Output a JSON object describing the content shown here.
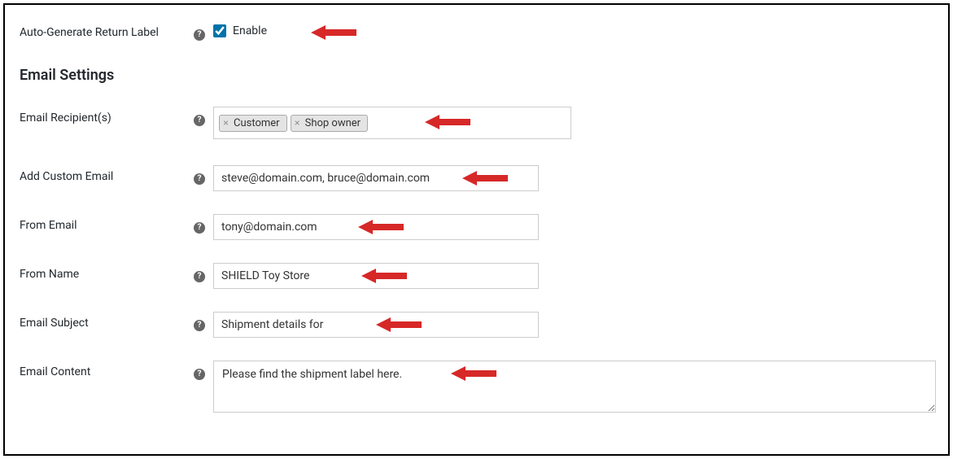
{
  "autoGenerate": {
    "label": "Auto-Generate Return Label",
    "checkboxLabel": "Enable",
    "checked": true
  },
  "sectionHeading": "Email Settings",
  "recipients": {
    "label": "Email Recipient(s)",
    "tags": [
      "Customer",
      "Shop owner"
    ]
  },
  "customEmail": {
    "label": "Add Custom Email",
    "value": "steve@domain.com, bruce@domain.com"
  },
  "fromEmail": {
    "label": "From Email",
    "value": "tony@domain.com"
  },
  "fromName": {
    "label": "From Name",
    "value": "SHIELD Toy Store"
  },
  "subject": {
    "label": "Email Subject",
    "value": "Shipment details for"
  },
  "content": {
    "label": "Email Content",
    "value": "Please find the shipment label here."
  },
  "helpGlyph": "?"
}
